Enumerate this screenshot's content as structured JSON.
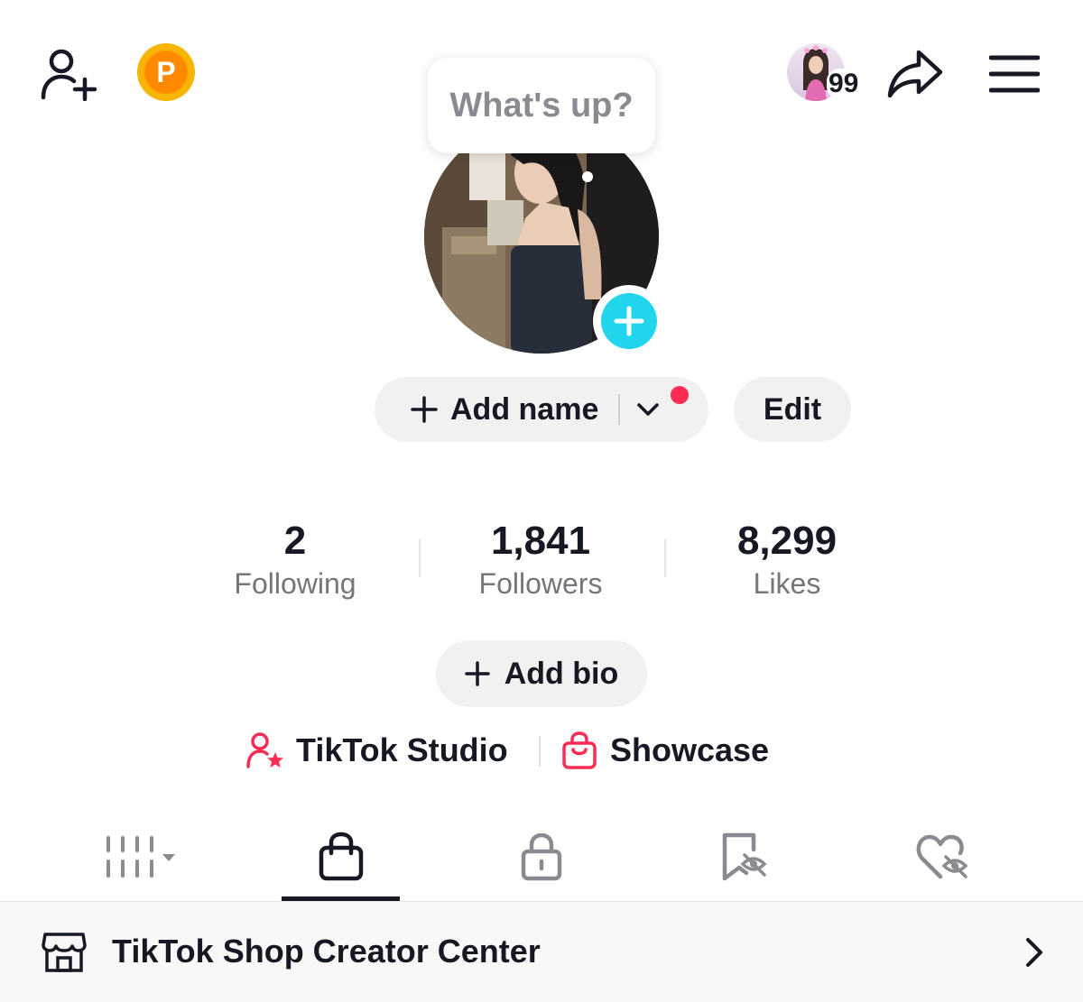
{
  "header": {
    "add_friend_icon": "person-plus-icon",
    "coin_icon": "points-coin-icon",
    "coin_letter": "P",
    "notification_count": "99",
    "share_icon": "share-arrow-icon",
    "menu_icon": "hamburger-menu-icon"
  },
  "bubble": {
    "text": "What's up?"
  },
  "profile": {
    "add_name_label": "Add name",
    "edit_label": "Edit",
    "add_bio_label": "Add bio"
  },
  "stats": [
    {
      "value": "2",
      "label": "Following"
    },
    {
      "value": "1,841",
      "label": "Followers"
    },
    {
      "value": "8,299",
      "label": "Likes"
    }
  ],
  "tools": {
    "studio_label": "TikTok Studio",
    "showcase_label": "Showcase"
  },
  "tabs": [
    {
      "icon": "grid-videos-icon",
      "active": false
    },
    {
      "icon": "shopping-bag-icon",
      "active": true
    },
    {
      "icon": "lock-icon",
      "active": false
    },
    {
      "icon": "bookmark-hidden-icon",
      "active": false
    },
    {
      "icon": "heart-hidden-icon",
      "active": false
    }
  ],
  "creator_center": {
    "label": "TikTok Shop Creator Center"
  },
  "colors": {
    "accent_red": "#fe2c55",
    "accent_cyan": "#20d5ec",
    "text_primary": "#161823",
    "text_secondary": "#75767c",
    "pill_bg": "#f1f1f2"
  }
}
